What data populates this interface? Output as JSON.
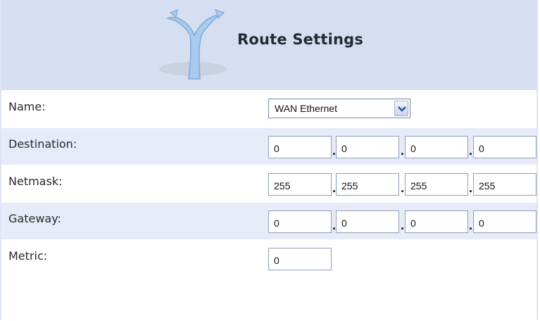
{
  "header": {
    "title": "Route Settings"
  },
  "fields": {
    "name": {
      "label": "Name:",
      "value": "WAN Ethernet"
    },
    "destination": {
      "label": "Destination:",
      "octets": [
        "0",
        "0",
        "0",
        "0"
      ]
    },
    "netmask": {
      "label": "Netmask:",
      "octets": [
        "255",
        "255",
        "255",
        "255"
      ]
    },
    "gateway": {
      "label": "Gateway:",
      "octets": [
        "0",
        "0",
        "0",
        "0"
      ]
    },
    "metric": {
      "label": "Metric:",
      "value": "0"
    }
  },
  "separator": "."
}
